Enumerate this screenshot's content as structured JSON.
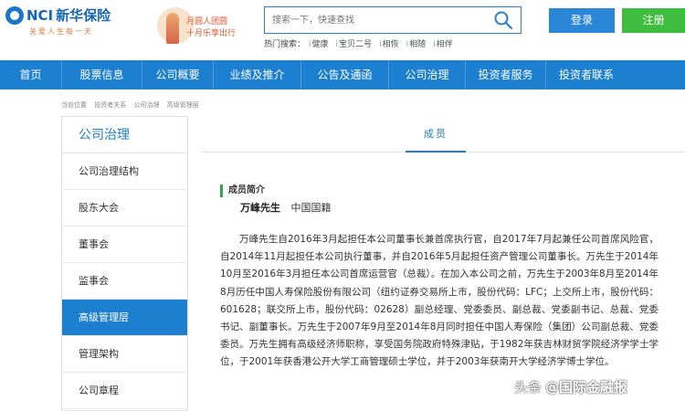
{
  "header": {
    "logo_nci": "NCI",
    "logo_cn": "新华保险",
    "logo_slogan": "关爱人生每一天",
    "banner_line1": "月圆人团圆",
    "banner_line2": "十月乐享出行",
    "search_placeholder": "搜索一下，快速查找",
    "hot_label": "热门搜索：",
    "hot_items": [
      "健康",
      "宝贝二号",
      "相恢",
      "相随",
      "相伴"
    ],
    "login_label": "登录",
    "register_label": "注册"
  },
  "nav": {
    "items": [
      "首页",
      "股票信息",
      "公司概要",
      "业绩及推介",
      "公告及通函",
      "公司治理",
      "投资者服务",
      "投资者联系"
    ]
  },
  "breadcrumb": [
    "当前位置",
    "投资者关系",
    "公司治理",
    "高级管理层"
  ],
  "sidebar": {
    "title": "公司治理",
    "items": [
      "公司治理结构",
      "股东大会",
      "董事会",
      "监事会",
      "高级管理层",
      "管理架构",
      "公司章程"
    ],
    "active_index": 4
  },
  "main": {
    "tab_label": "成员",
    "section_title": "成员简介",
    "person_name": "万峰先生",
    "person_nationality": "中国国籍",
    "bio": "万峰先生自2016年3月起担任本公司董事长兼首席执行官，自2017年7月起兼任公司首席风险官，自2014年11月起担任本公司执行董事，并自2016年5月起担任资产管理公司董事长。万先生于2014年10月至2016年3月担任本公司首席运营官（总裁）。在加入本公司之前，万先生于2003年8月至2014年8月历任中国人寿保险股份有限公司（纽约证券交易所上市，股份代码：LFC；上交所上市，股份代码：601628；联交所上市，股份代码：02628）副总经理、党委委员、副总裁、党委副书记、总裁、党委书记、副董事长。万先生于2007年9月至2014年8月同时担任中国人寿保险（集团）公司副总裁、党委委员。万先生拥有高级经济师职称，享受国务院政府特殊津贴，于1982年获吉林财贸学院经济学学士学位，于2001年获香港公开大学工商管理硕士学位，并于2003年获南开大学经济学博士学位。"
  },
  "watermark": {
    "source": "头条",
    "handle": "@国际金融报"
  },
  "colors": {
    "brand_blue": "#1d7fd0",
    "register_green": "#3fbd3f",
    "section_accent": "#2fa84f"
  }
}
